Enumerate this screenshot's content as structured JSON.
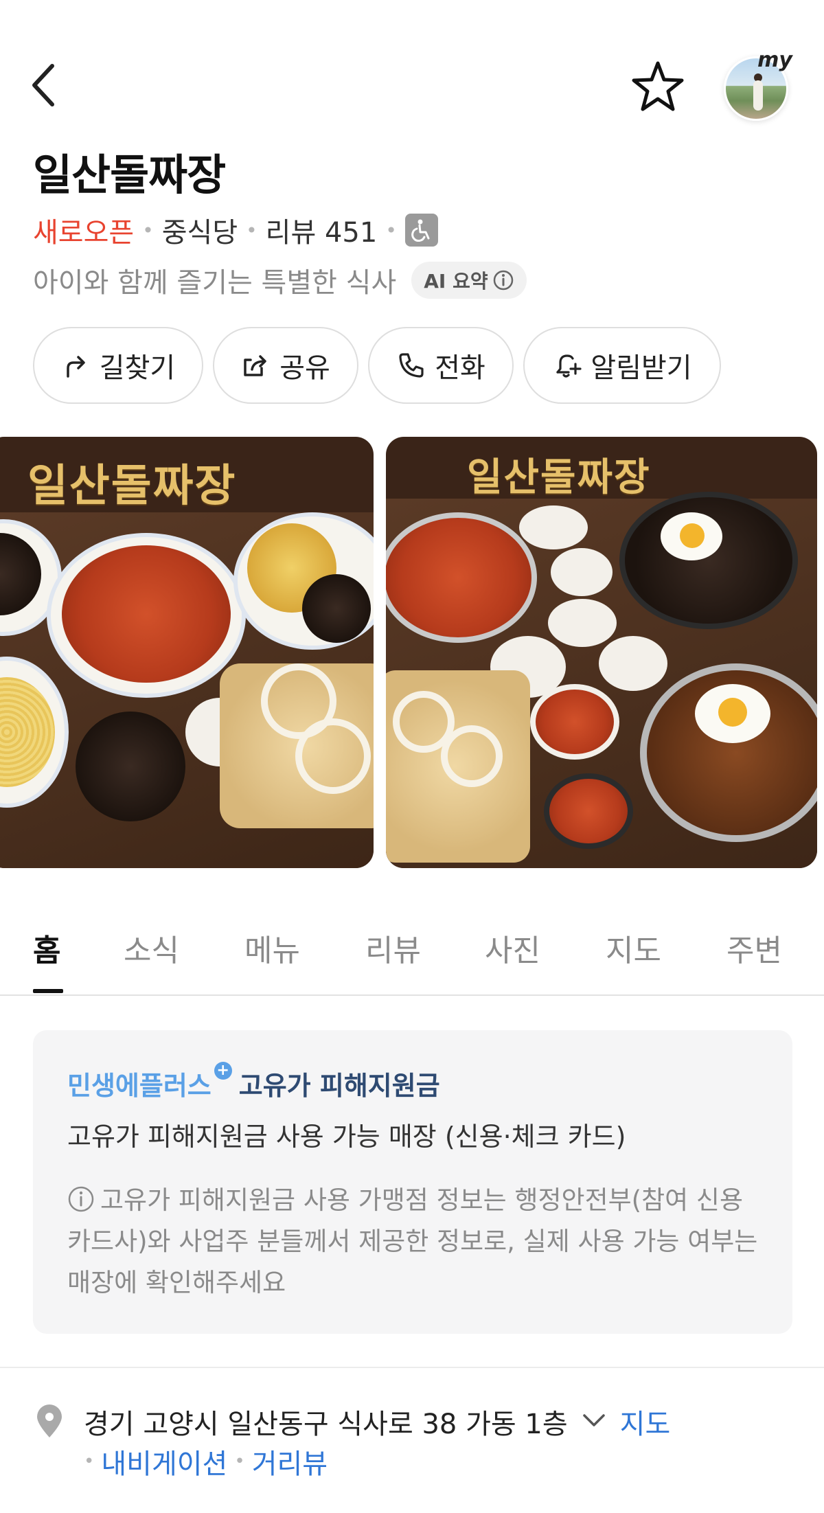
{
  "place": {
    "name": "일산돌짜장",
    "status": "새로오픈",
    "category": "중식당",
    "review_label": "리뷰 451",
    "summary": "아이와 함께 즐기는 특별한 식사",
    "ai_badge": "AI 요약"
  },
  "header": {
    "avatar_badge": "my"
  },
  "actions": {
    "route": "길찾기",
    "share": "공유",
    "call": "전화",
    "alarm": "알림받기"
  },
  "photos": {
    "sign_text": "일산돌짜장"
  },
  "tabs": [
    "홈",
    "소식",
    "메뉴",
    "리뷰",
    "사진",
    "지도",
    "주변"
  ],
  "info_card": {
    "brand": "민생에플러스",
    "program": "고유가 피해지원금",
    "line": "고유가 피해지원금 사용 가능 매장 (신용·체크 카드)",
    "note": "고유가 피해지원금 사용 가맹점 정보는 행정안전부(참여 신용카드사)와 사업주 분들께서 제공한 정보로, 실제 사용 가능 여부는 매장에 확인해주세요"
  },
  "address": {
    "text": "경기 고양시 일산동구 식사로 38 가동 1층",
    "map_link": "지도",
    "navigation_link": "내비게이션",
    "streetview_link": "거리뷰"
  },
  "colors": {
    "accent_new": "#e8432f",
    "link": "#2f76d6",
    "brand_blue": "#5aa0e6"
  }
}
